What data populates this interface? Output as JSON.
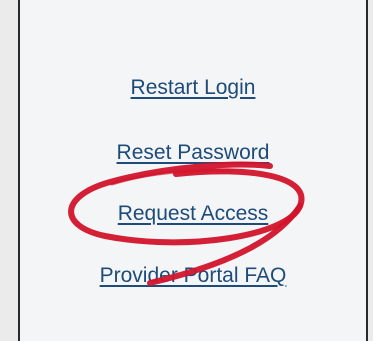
{
  "links": {
    "restart_login": "Restart Login",
    "reset_password": "Reset Password",
    "request_access": "Request Access",
    "provider_portal_faq": "Provider Portal FAQ"
  },
  "colors": {
    "link": "#1d4b7a",
    "annotation_stroke": "#d2142b",
    "panel_bg": "#f4f5f7",
    "border": "#2a2a2a"
  },
  "annotation": {
    "type": "hand-drawn-ellipse",
    "highlights": "request_access"
  }
}
